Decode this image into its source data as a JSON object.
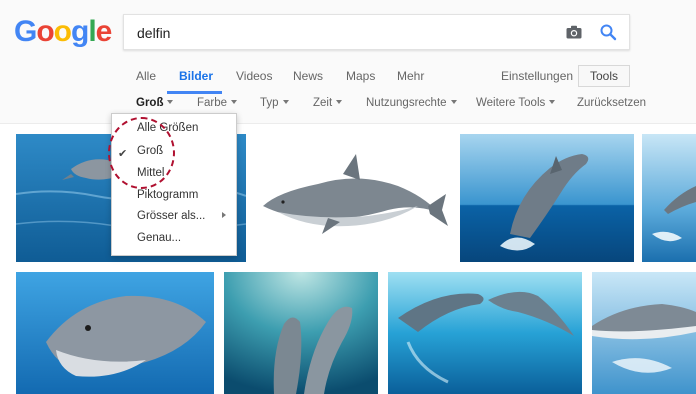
{
  "logo": {
    "letters": [
      "G",
      "o",
      "o",
      "g",
      "l",
      "e"
    ]
  },
  "search": {
    "query": "delfin",
    "camera_icon": "camera-icon",
    "search_icon": "search-icon"
  },
  "tabs": [
    {
      "label": "Alle",
      "active": false
    },
    {
      "label": "Bilder",
      "active": true
    },
    {
      "label": "Videos",
      "active": false
    },
    {
      "label": "News",
      "active": false
    },
    {
      "label": "Maps",
      "active": false
    },
    {
      "label": "Mehr",
      "active": false
    }
  ],
  "settings_label": "Einstellungen",
  "tools_label": "Tools",
  "filters": [
    {
      "label": "Groß",
      "active": true
    },
    {
      "label": "Farbe",
      "active": false
    },
    {
      "label": "Typ",
      "active": false
    },
    {
      "label": "Zeit",
      "active": false
    },
    {
      "label": "Nutzungsrechte",
      "active": false
    },
    {
      "label": "Weitere Tools",
      "active": false
    }
  ],
  "reset_label": "Zurücksetzen",
  "size_menu": {
    "items": [
      {
        "label": "Alle Größen",
        "checked": false
      },
      {
        "label": "Groß",
        "checked": true
      },
      {
        "label": "Mittel",
        "checked": false
      },
      {
        "label": "Piktogramm",
        "checked": false
      },
      {
        "label": "Grösser als...",
        "checked": false,
        "has_submenu": true
      },
      {
        "label": "Genau...",
        "checked": false
      }
    ],
    "check_glyph": "✔"
  },
  "colors": {
    "accent": "#4285f4",
    "annotation": "#b01030",
    "ocean": "#1d78b5",
    "sky": "#8fc6e6"
  }
}
